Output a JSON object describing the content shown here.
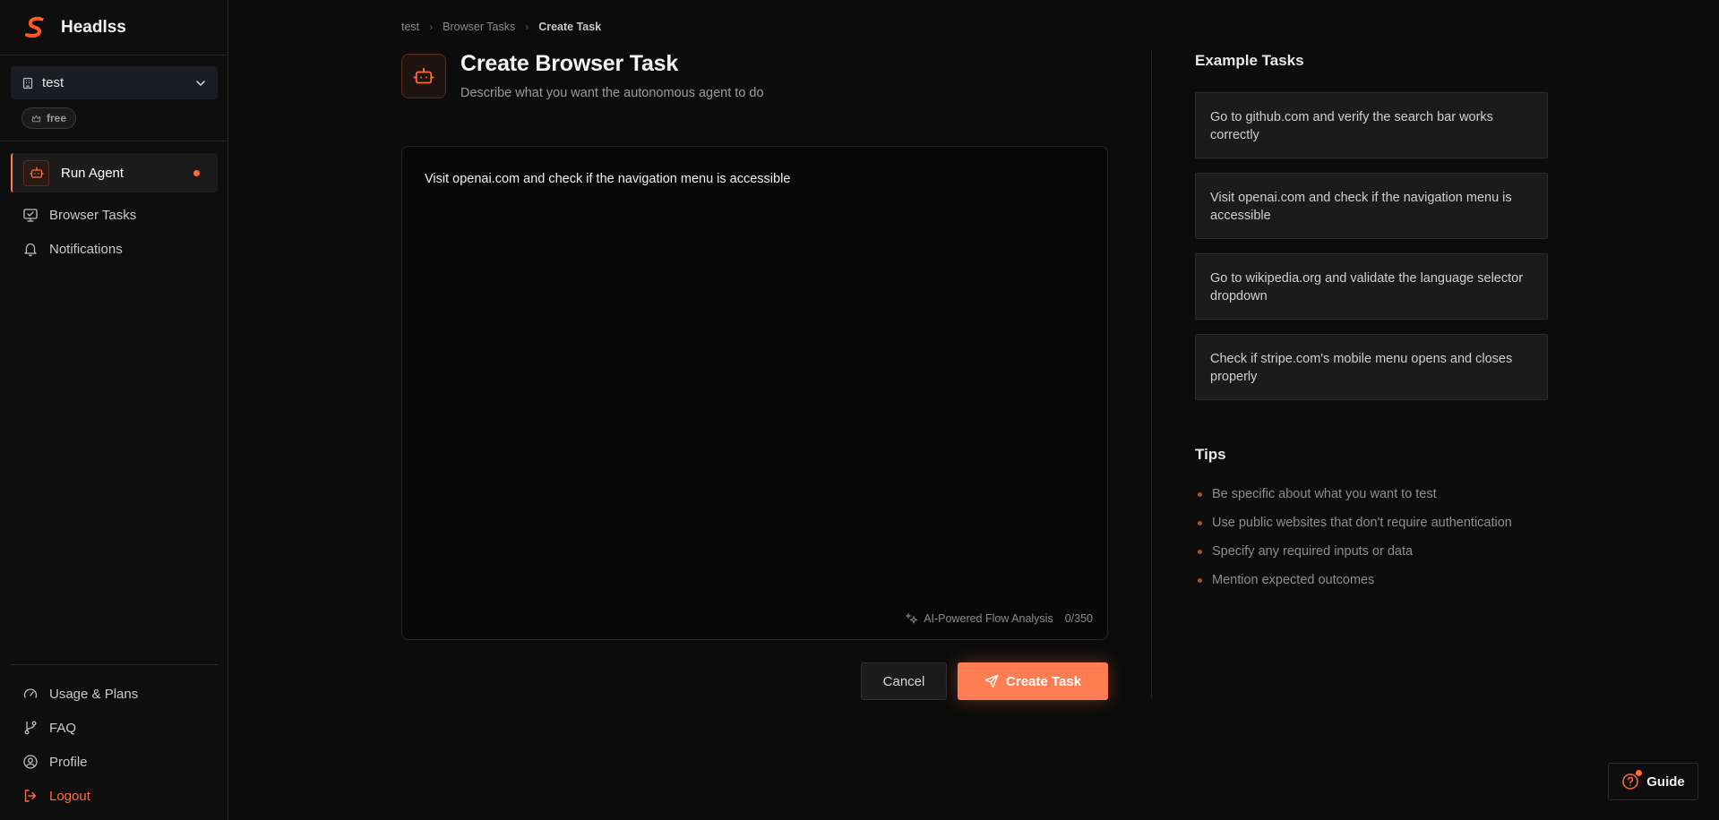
{
  "brand": {
    "name": "Headlss"
  },
  "workspace": {
    "name": "test",
    "plan": "free"
  },
  "nav": {
    "run_agent": "Run Agent",
    "browser_tasks": "Browser Tasks",
    "notifications": "Notifications",
    "usage": "Usage & Plans",
    "faq": "FAQ",
    "profile": "Profile",
    "logout": "Logout"
  },
  "breadcrumb": [
    "test",
    "Browser Tasks",
    "Create Task"
  ],
  "header": {
    "title": "Create Browser Task",
    "subtitle": "Describe what you want the autonomous agent to do"
  },
  "task": {
    "value": "Visit openai.com and check if the navigation menu is accessible",
    "ai_label": "AI-Powered Flow Analysis",
    "counter": "0/350"
  },
  "actions": {
    "cancel": "Cancel",
    "create": "Create Task"
  },
  "examples": {
    "title": "Example Tasks",
    "items": [
      "Go to github.com and verify the search bar works correctly",
      "Visit openai.com and check if the navigation menu is accessible",
      "Go to wikipedia.org and validate the language selector dropdown",
      "Check if stripe.com's mobile menu opens and closes properly"
    ]
  },
  "tips": {
    "title": "Tips",
    "items": [
      "Be specific about what you want to test",
      "Use public websites that don't require authentication",
      "Specify any required inputs or data",
      "Mention expected outcomes"
    ]
  },
  "guide": {
    "label": "Guide"
  },
  "colors": {
    "accent": "#ff7d52",
    "background": "#0c0c0c",
    "logout": "#ff6a45"
  }
}
